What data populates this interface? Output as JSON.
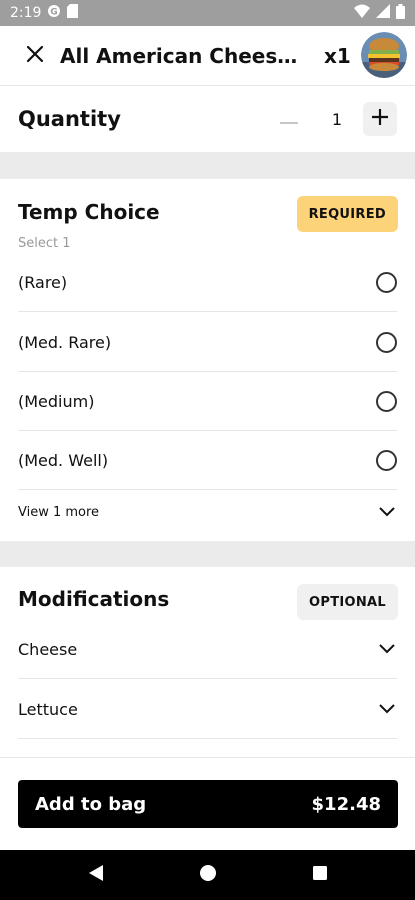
{
  "status_bar": {
    "time": "2:19"
  },
  "header": {
    "title": "All American Cheeseb...",
    "quantity_suffix": "x1"
  },
  "quantity": {
    "label": "Quantity",
    "value": "1"
  },
  "temp_choice": {
    "title": "Temp Choice",
    "badge": "REQUIRED",
    "subtitle": "Select 1",
    "options": [
      {
        "label": "(Rare)"
      },
      {
        "label": "(Med. Rare)"
      },
      {
        "label": "(Medium)"
      },
      {
        "label": "(Med. Well)"
      }
    ],
    "view_more": "View 1 more"
  },
  "modifications": {
    "title": "Modifications",
    "badge": "OPTIONAL",
    "items": [
      {
        "label": "Cheese"
      },
      {
        "label": "Lettuce"
      }
    ]
  },
  "footer": {
    "add_label": "Add to bag",
    "price": "$12.48"
  },
  "colors": {
    "required_badge": "#fdd37a",
    "optional_badge": "#f0f0f0",
    "cta_background": "#000000",
    "status_bar": "#9e9e9e"
  },
  "icons": {
    "close": "close-icon",
    "minus": "minus-icon",
    "plus": "plus-icon",
    "radio": "radio-unchecked-icon",
    "chevron": "chevron-down-icon",
    "nav_back": "back-triangle-icon",
    "nav_home": "home-circle-icon",
    "nav_recents": "recents-square-icon"
  }
}
